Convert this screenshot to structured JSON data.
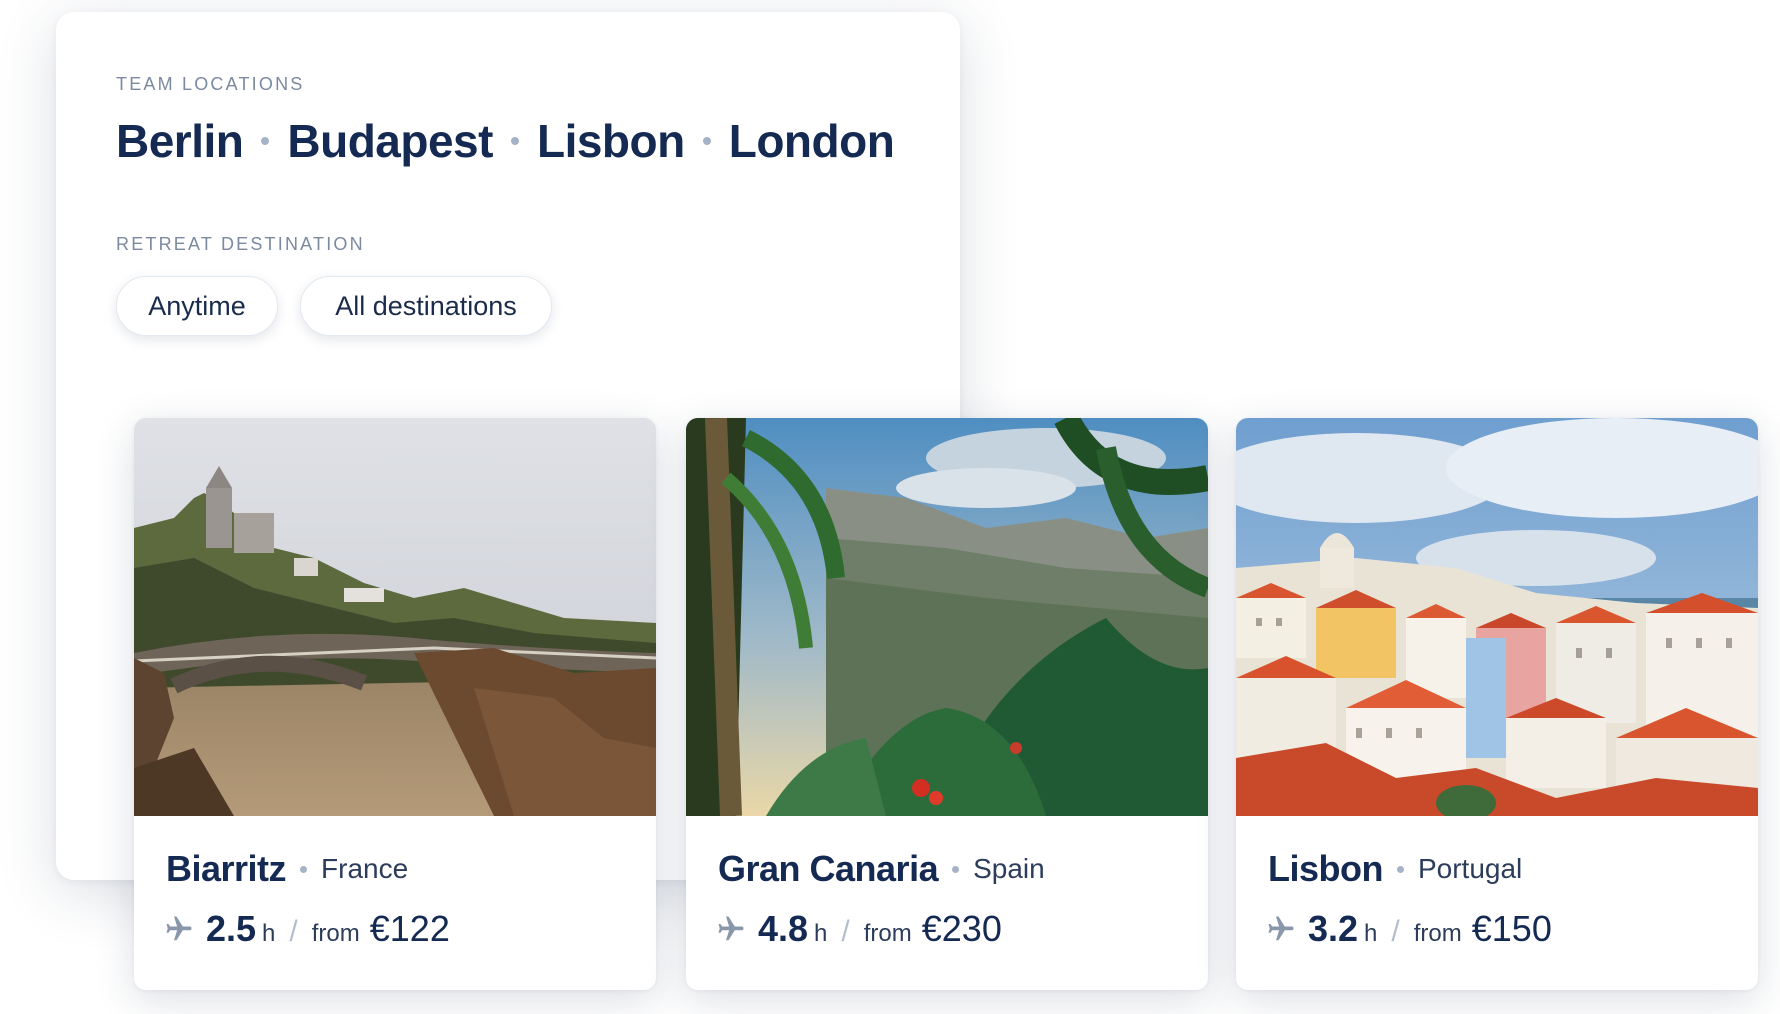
{
  "team": {
    "label": "TEAM LOCATIONS",
    "cities": [
      "Berlin",
      "Budapest",
      "Lisbon",
      "London"
    ]
  },
  "retreat": {
    "label": "RETREAT DESTINATION",
    "filters": {
      "time": "Anytime",
      "destinations": "All destinations"
    }
  },
  "destinations": [
    {
      "city": "Biarritz",
      "country": "France",
      "hours": "2.5",
      "hours_unit": "h",
      "from_label": "from",
      "price": "€122",
      "icon": "plane-icon"
    },
    {
      "city": "Gran Canaria",
      "country": "Spain",
      "hours": "4.8",
      "hours_unit": "h",
      "from_label": "from",
      "price": "€230",
      "icon": "plane-icon"
    },
    {
      "city": "Lisbon",
      "country": "Portugal",
      "hours": "3.2",
      "hours_unit": "h",
      "from_label": "from",
      "price": "€150",
      "icon": "plane-icon"
    }
  ],
  "colors": {
    "heading": "#152a52",
    "muted": "#7b8aa1",
    "dot": "#a6b3c6"
  }
}
